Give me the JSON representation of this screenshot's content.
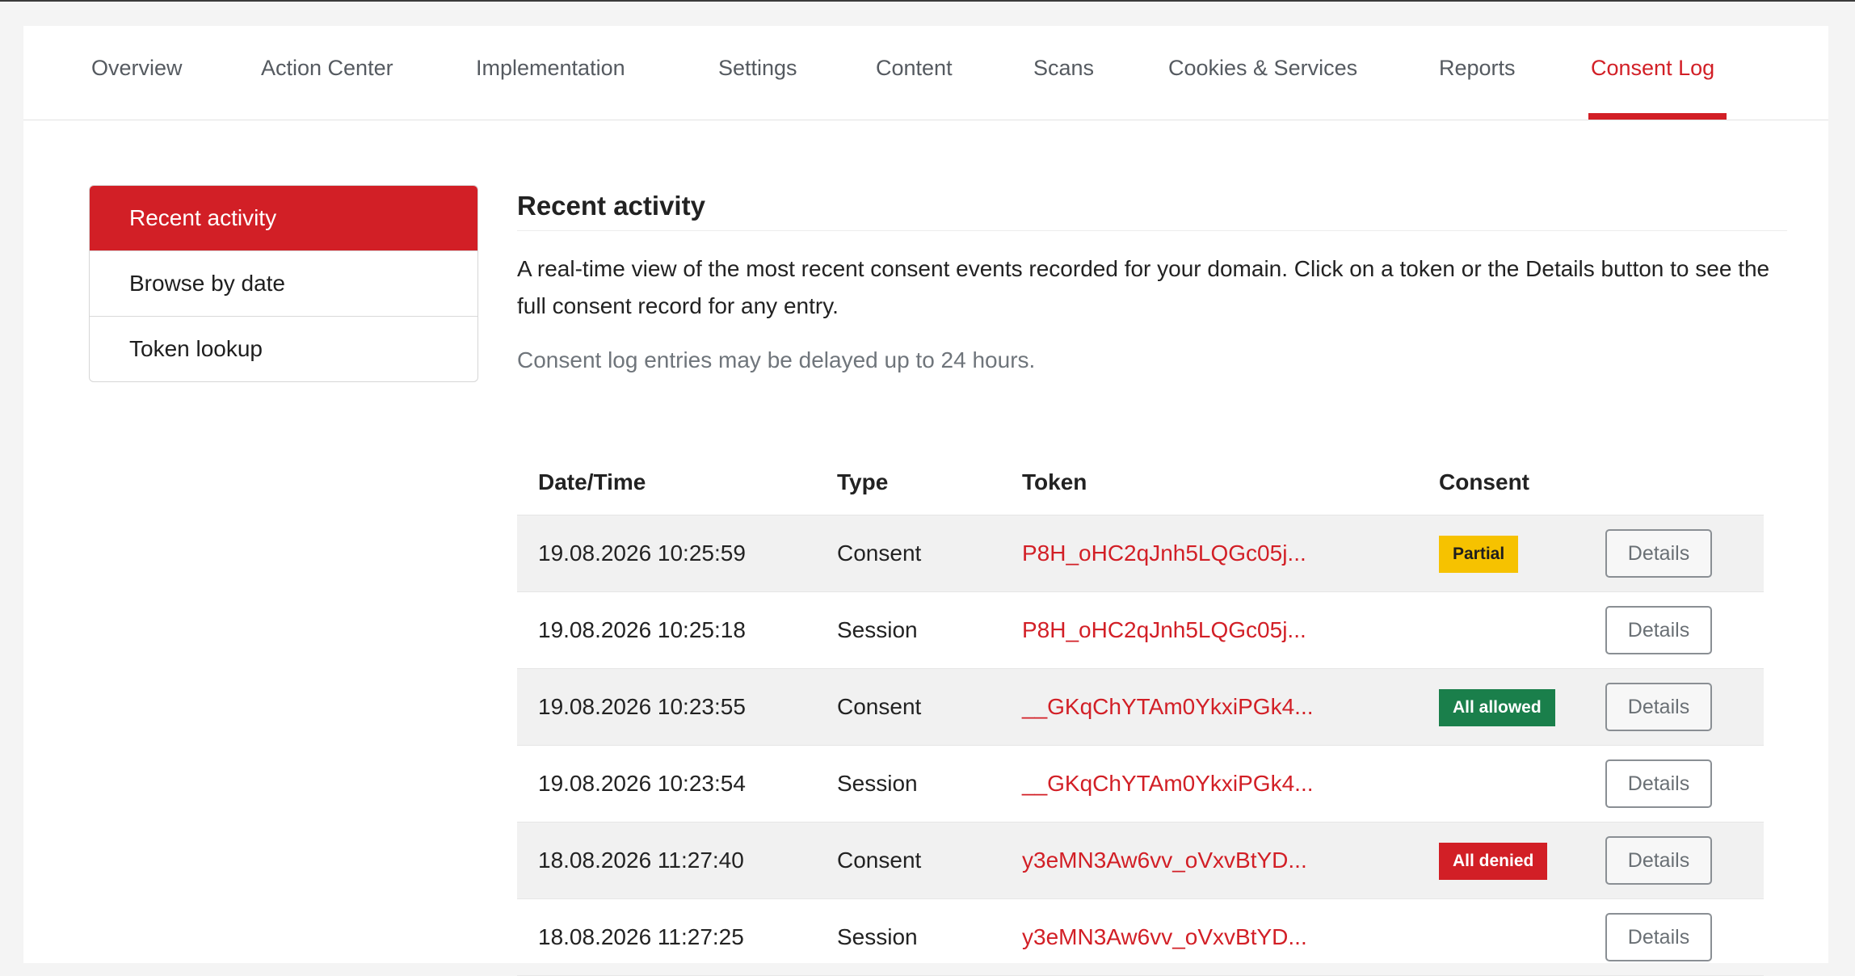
{
  "tabs": [
    {
      "label": "Overview",
      "active": false
    },
    {
      "label": "Action Center",
      "active": false
    },
    {
      "label": "Implementation",
      "active": false
    },
    {
      "label": "Settings",
      "active": false
    },
    {
      "label": "Content",
      "active": false
    },
    {
      "label": "Scans",
      "active": false
    },
    {
      "label": "Cookies & Services",
      "active": false
    },
    {
      "label": "Reports",
      "active": false
    },
    {
      "label": "Consent Log",
      "active": true
    }
  ],
  "sidebar": {
    "items": [
      {
        "label": "Recent activity",
        "active": true
      },
      {
        "label": "Browse by date",
        "active": false
      },
      {
        "label": "Token lookup",
        "active": false
      }
    ]
  },
  "main": {
    "title": "Recent activity",
    "description": "A real-time view of the most recent consent events recorded for your domain. Click on a token or the Details button to see the full consent record for any entry.",
    "note": "Consent log entries may be delayed up to 24 hours."
  },
  "table": {
    "headers": {
      "datetime": "Date/Time",
      "type": "Type",
      "token": "Token",
      "consent": "Consent"
    },
    "details_label": "Details",
    "rows": [
      {
        "datetime": "19.08.2026 10:25:59",
        "type": "Consent",
        "token": "P8H_oHC2qJnh5LQGc05j...",
        "consent": "Partial"
      },
      {
        "datetime": "19.08.2026 10:25:18",
        "type": "Session",
        "token": "P8H_oHC2qJnh5LQGc05j...",
        "consent": ""
      },
      {
        "datetime": "19.08.2026 10:23:55",
        "type": "Consent",
        "token": "__GKqChYTAm0YkxiPGk4...",
        "consent": "All allowed"
      },
      {
        "datetime": "19.08.2026 10:23:54",
        "type": "Session",
        "token": "__GKqChYTAm0YkxiPGk4...",
        "consent": ""
      },
      {
        "datetime": "18.08.2026 11:27:40",
        "type": "Consent",
        "token": "y3eMN3Aw6vv_oVxvBtYD...",
        "consent": "All denied"
      },
      {
        "datetime": "18.08.2026 11:27:25",
        "type": "Session",
        "token": "y3eMN3Aw6vv_oVxvBtYD...",
        "consent": ""
      }
    ]
  },
  "colors": {
    "accent": "#d21f26",
    "partial": "#f6c200",
    "allowed": "#1a7f4b",
    "denied": "#d21f26"
  }
}
